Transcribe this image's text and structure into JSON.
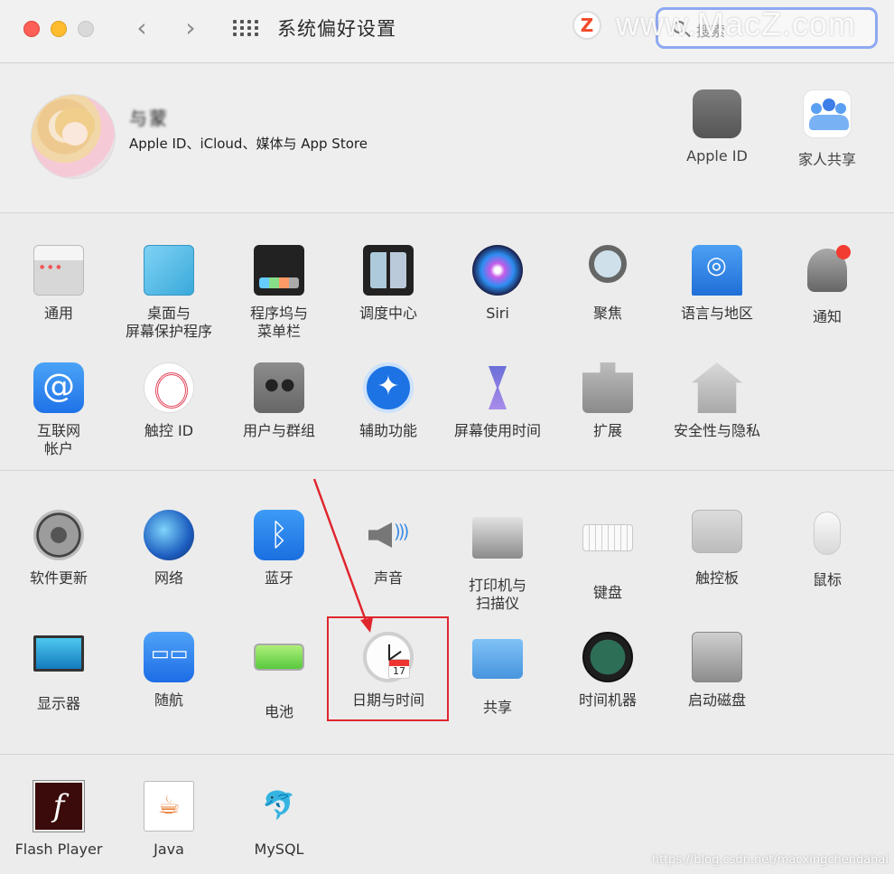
{
  "window": {
    "title": "系统偏好设置",
    "nav_back": "‹",
    "nav_forward": "›"
  },
  "search": {
    "placeholder": "搜索"
  },
  "watermark": {
    "logo": "Z",
    "text": "www.MacZ.com",
    "csdn": "https://blog.csdn.net/macxingchendahai"
  },
  "account": {
    "name": "与蒙",
    "subtitle": "Apple ID、iCloud、媒体与 App Store",
    "items": [
      {
        "label": "Apple ID",
        "icon": "apple-icon"
      },
      {
        "label": "家人共享",
        "icon": "family-icon"
      }
    ]
  },
  "section1": {
    "row1": [
      {
        "label": "通用",
        "icon": "general-icon"
      },
      {
        "label": "桌面与",
        "label2": "屏幕保护程序",
        "icon": "desktop-icon"
      },
      {
        "label": "程序坞与",
        "label2": "菜单栏",
        "icon": "dock-icon"
      },
      {
        "label": "调度中心",
        "icon": "mission-control-icon"
      },
      {
        "label": "Siri",
        "icon": "siri-icon"
      },
      {
        "label": "聚焦",
        "icon": "spotlight-icon"
      },
      {
        "label": "语言与地区",
        "icon": "language-icon"
      },
      {
        "label": "通知",
        "icon": "notification-icon"
      }
    ],
    "row2": [
      {
        "label": "互联网",
        "label2": "帐户",
        "icon": "internet-accounts-icon",
        "glyph": "@"
      },
      {
        "label": "触控 ID",
        "icon": "touch-id-icon"
      },
      {
        "label": "用户与群组",
        "icon": "users-icon"
      },
      {
        "label": "辅助功能",
        "icon": "accessibility-icon",
        "glyph": "✦"
      },
      {
        "label": "屏幕使用时间",
        "icon": "screen-time-icon"
      },
      {
        "label": "扩展",
        "icon": "extensions-icon"
      },
      {
        "label": "安全性与隐私",
        "icon": "security-icon"
      }
    ]
  },
  "section2": {
    "row1": [
      {
        "label": "软件更新",
        "icon": "software-update-icon"
      },
      {
        "label": "网络",
        "icon": "network-icon"
      },
      {
        "label": "蓝牙",
        "icon": "bluetooth-icon",
        "glyph": "ᛒ"
      },
      {
        "label": "声音",
        "icon": "sound-icon"
      },
      {
        "label": "打印机与",
        "label2": "扫描仪",
        "icon": "printer-icon"
      },
      {
        "label": "键盘",
        "icon": "keyboard-icon"
      },
      {
        "label": "触控板",
        "icon": "trackpad-icon"
      },
      {
        "label": "鼠标",
        "icon": "mouse-icon"
      }
    ],
    "row2": [
      {
        "label": "显示器",
        "icon": "display-icon"
      },
      {
        "label": "随航",
        "icon": "sidecar-icon"
      },
      {
        "label": "电池",
        "icon": "battery-icon"
      },
      {
        "label": "日期与时间",
        "icon": "date-time-icon",
        "badge": "17"
      },
      {
        "label": "共享",
        "icon": "sharing-icon"
      },
      {
        "label": "时间机器",
        "icon": "time-machine-icon"
      },
      {
        "label": "启动磁盘",
        "icon": "startup-disk-icon"
      }
    ]
  },
  "section3": {
    "row1": [
      {
        "label": "Flash Player",
        "icon": "flash-icon",
        "glyph": "f"
      },
      {
        "label": "Java",
        "icon": "java-icon",
        "glyph": "☕"
      },
      {
        "label": "MySQL",
        "icon": "mysql-icon",
        "glyph": "🐬"
      }
    ]
  },
  "colors": {
    "highlight": "#e0262d",
    "arrow": "#e0262d"
  }
}
